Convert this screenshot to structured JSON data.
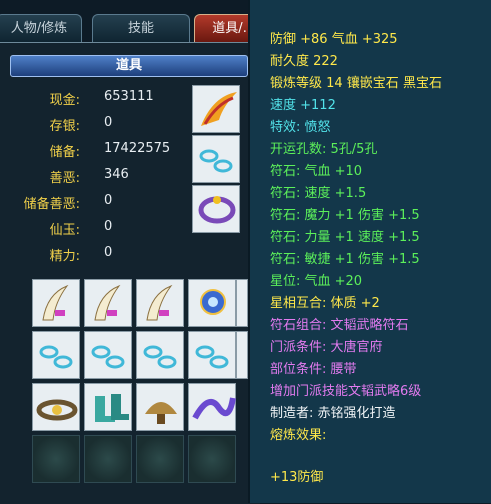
{
  "tabs": [
    {
      "label": "人物/修炼",
      "active": false
    },
    {
      "label": "技能",
      "active": false
    },
    {
      "label": "道具/…",
      "active": true
    }
  ],
  "panel": {
    "header": "道具",
    "stats": [
      {
        "label": "现金:",
        "value": "653111"
      },
      {
        "label": "存银:",
        "value": "0"
      },
      {
        "label": "储备:",
        "value": "17422575"
      },
      {
        "label": "善恶:",
        "value": "346"
      },
      {
        "label": "储备善恶:",
        "value": "0"
      },
      {
        "label": "仙玉:",
        "value": "0"
      },
      {
        "label": "精力:",
        "value": "0"
      }
    ]
  },
  "tooltip": {
    "lines": [
      {
        "text": "防御 +86 气血 +325",
        "color": "yellow"
      },
      {
        "text": "耐久度 222",
        "color": "yellow"
      },
      {
        "text": "锻炼等级 14 镶嵌宝石 黑宝石",
        "color": "yellow"
      },
      {
        "text": "速度 +112",
        "color": "cyan"
      },
      {
        "text": "特效: 愤怒",
        "color": "cyan"
      },
      {
        "text": "开运孔数: 5孔/5孔",
        "color": "green"
      },
      {
        "text": "符石: 气血 +10",
        "color": "green"
      },
      {
        "text": "符石: 速度 +1.5",
        "color": "green"
      },
      {
        "text": "符石: 魔力 +1 伤害 +1.5",
        "color": "green"
      },
      {
        "text": "符石: 力量 +1 速度 +1.5",
        "color": "green"
      },
      {
        "text": "符石: 敏捷 +1 伤害 +1.5",
        "color": "green"
      },
      {
        "text": "星位: 气血 +20",
        "color": "green"
      },
      {
        "text": "星相互合: 体质 +2",
        "color": "yellow"
      },
      {
        "text": "符石组合: 文韬武略符石",
        "color": "purple"
      },
      {
        "text": "门派条件: 大唐官府",
        "color": "purple"
      },
      {
        "text": "部位条件: 腰带",
        "color": "purple"
      },
      {
        "text": "增加门派技能文韬武略6级",
        "color": "purple"
      },
      {
        "text": "制造者: 赤铭强化打造",
        "color": "white"
      },
      {
        "text": "熔炼效果:",
        "color": "yellow"
      },
      {
        "text": "",
        "color": "yellow"
      },
      {
        "text": "+13防御",
        "color": "yellow"
      }
    ]
  },
  "colors": {
    "yellow": "#ffe84a",
    "cyan": "#52e3ea",
    "green": "#5cf05a",
    "purple": "#e37bf0",
    "white": "#f0f4f6",
    "active_tab": "#b33a2b",
    "panel_bg": "#13232e",
    "tooltip_bg": "#13374a"
  },
  "inventory": {
    "top_slots": [
      "flame-claw-icon",
      "jade-chain-icon",
      "jewel-bracelet-icon"
    ],
    "grid_rows": [
      [
        "tusk-blade-icon",
        "tusk-blade-icon",
        "tusk-blade-icon",
        "glowing-orb-icon",
        "tusk-blade-icon"
      ],
      [
        "jade-chain-icon",
        "jade-chain-icon",
        "jade-chain-icon",
        "jade-chain-icon",
        "jade-chain-icon"
      ],
      [
        "gold-belt-icon",
        "boots-icon",
        "saddle-icon",
        "ribbon-icon",
        "empty-slot"
      ],
      [
        "empty-slot",
        "empty-slot",
        "empty-slot",
        "empty-slot",
        "empty-slot"
      ]
    ]
  }
}
